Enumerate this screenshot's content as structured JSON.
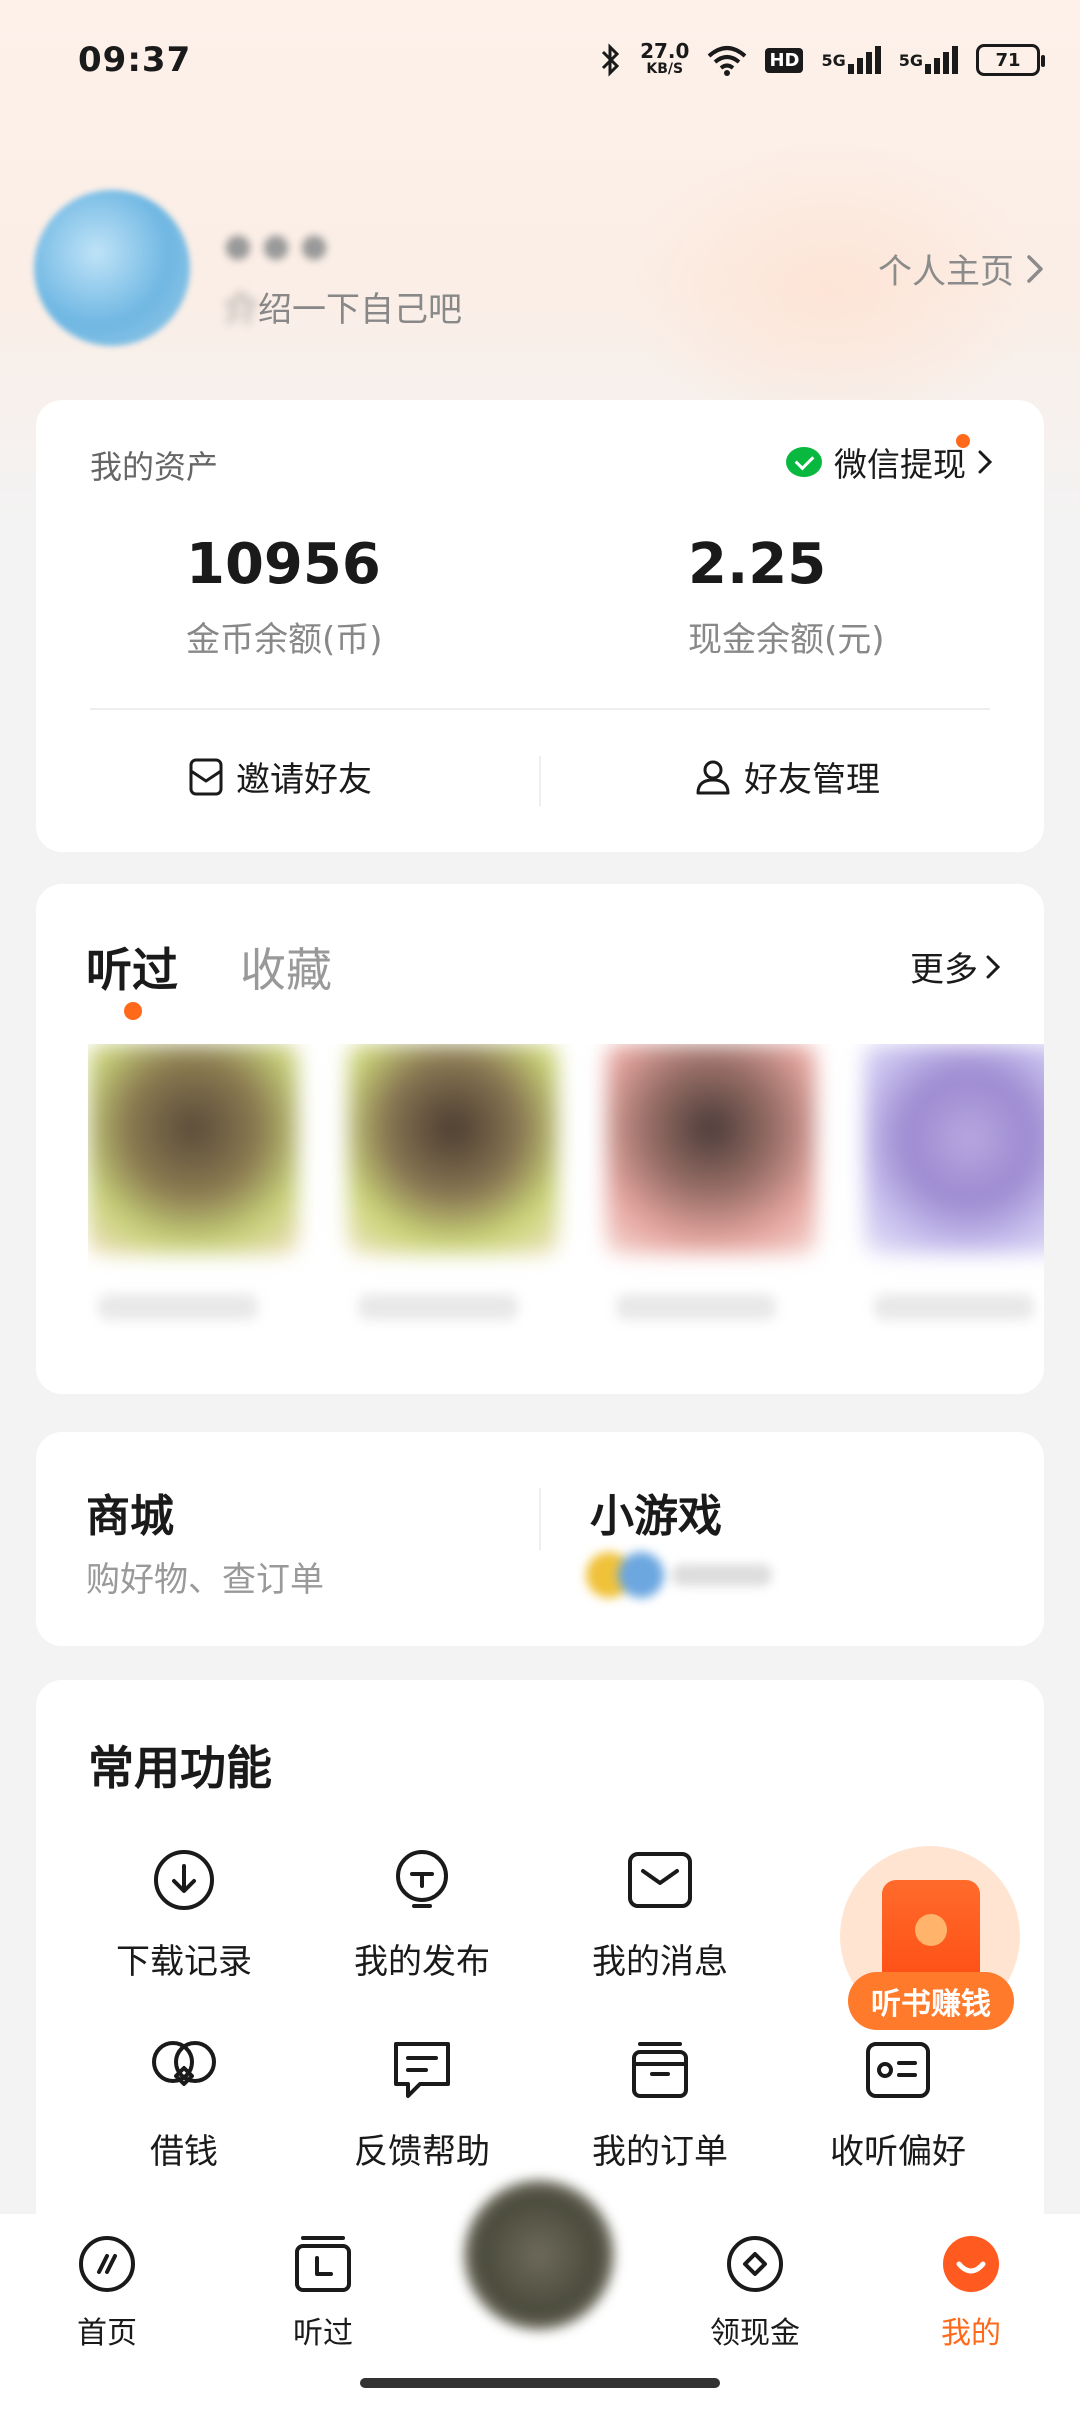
{
  "status_bar": {
    "time": "09:37",
    "net_speed_value": "27.0",
    "net_speed_unit": "KB/S",
    "hd_label": "HD",
    "sig1_label": "5G",
    "sig2_label": "5G",
    "battery": "71"
  },
  "profile": {
    "bio_suffix": "绍一下自己吧",
    "homepage_label": "个人主页"
  },
  "assets": {
    "title": "我的资产",
    "withdraw_label": "微信提现",
    "coins_value": "10956",
    "coins_label": "金币余额(币)",
    "cash_value": "2.25",
    "cash_label": "现金余额(元)",
    "invite_label": "邀请好友",
    "friends_label": "好友管理"
  },
  "history": {
    "tab_listened": "听过",
    "tab_favorites": "收藏",
    "more_label": "更多"
  },
  "mall": {
    "title": "商城",
    "subtitle": "购好物、查订单",
    "game_title": "小游戏"
  },
  "functions": {
    "title": "常用功能",
    "items": [
      {
        "label": "下载记录",
        "icon": "download-icon"
      },
      {
        "label": "我的发布",
        "icon": "publish-icon"
      },
      {
        "label": "我的消息",
        "icon": "message-icon"
      },
      {
        "label": "借钱",
        "icon": "loan-icon"
      },
      {
        "label": "反馈帮助",
        "icon": "feedback-icon"
      },
      {
        "label": "我的订单",
        "icon": "order-icon"
      },
      {
        "label": "收听偏好",
        "icon": "preference-icon"
      }
    ]
  },
  "floating": {
    "earn_label": "听书赚钱"
  },
  "nav": {
    "home": "首页",
    "listened": "听过",
    "cash": "领现金",
    "mine": "我的"
  },
  "colors": {
    "accent": "#ff6a1a",
    "wechat_green": "#09b83e"
  }
}
